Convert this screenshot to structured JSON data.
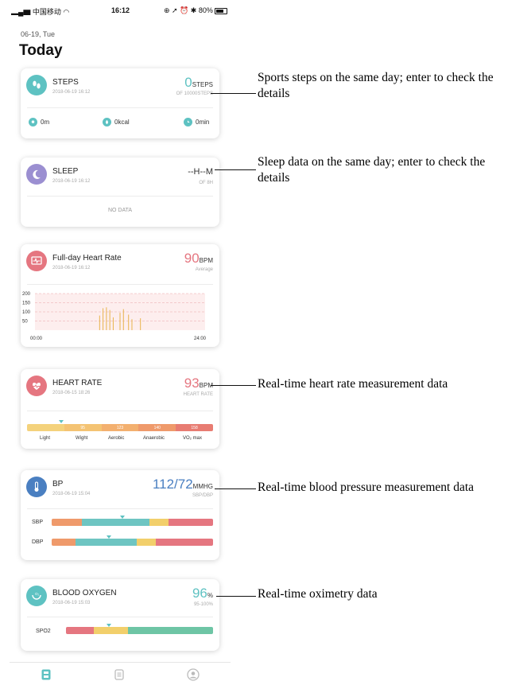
{
  "status_bar": {
    "carrier": "中国移动",
    "time": "16:12",
    "battery": "80%"
  },
  "header": {
    "date": "06-19, Tue",
    "title": "Today"
  },
  "steps": {
    "title": "STEPS",
    "time": "2018-06-19 16:12",
    "value": "0",
    "unit": "STEPS",
    "goal": "OF 10000STEPS",
    "distance": "0m",
    "calories": "0kcal",
    "duration": "0min"
  },
  "sleep": {
    "title": "SLEEP",
    "time": "2018-06-19 16:12",
    "value": "--H--M",
    "goal": "OF 8H",
    "empty": "NO DATA"
  },
  "fullday_hr": {
    "title": "Full-day Heart Rate",
    "time": "2018-06-19 16:12",
    "value": "90",
    "unit": "BPM",
    "note": "Average",
    "y_ticks": [
      "200",
      "150",
      "100",
      "50"
    ],
    "x_start": "00:00",
    "x_end": "24:00"
  },
  "heart_rate": {
    "title": "HEART RATE",
    "time": "2018-06-15 18:26",
    "value": "93",
    "unit": "BPM",
    "note": "HEART RATE",
    "marks": [
      "95",
      "123",
      "140",
      "158"
    ],
    "zones": [
      "Light",
      "Wight",
      "Aerobic",
      "Anaerobic",
      "VO₂ max"
    ]
  },
  "bp": {
    "title": "BP",
    "time": "2018-06-19 15:04",
    "value": "112/72",
    "unit": "MMHG",
    "note": "SBP/DBP",
    "sbp_label": "SBP",
    "dbp_label": "DBP"
  },
  "oxygen": {
    "title": "BLOOD OXYGEN",
    "time": "2018-06-19 15:03",
    "value": "96",
    "unit": "%",
    "note": "95-100%",
    "label": "SPO2"
  },
  "annotations": {
    "steps": "Sports steps on the same day; enter to check the details",
    "sleep": "Sleep data on the same day; enter to check the details",
    "hr": "Real-time heart rate measurement data",
    "bp": "Real-time blood pressure measurement data",
    "oxygen": "Real-time oximetry data"
  },
  "colors": {
    "teal": "#5ec2c2",
    "red": "#e57680",
    "blue": "#4a7fc1",
    "purple": "#9b8fd1",
    "orange": "#ef9a6b",
    "yellow": "#f2cf6b"
  },
  "chart_data": {
    "type": "bar",
    "title": "Full-day Heart Rate",
    "x_labels": [
      "00:00",
      "24:00"
    ],
    "ylim": [
      0,
      200
    ],
    "y_ticks": [
      50,
      100,
      150,
      200
    ],
    "bars": [
      {
        "x": 0.38,
        "y": 80
      },
      {
        "x": 0.4,
        "y": 120
      },
      {
        "x": 0.42,
        "y": 125
      },
      {
        "x": 0.44,
        "y": 110
      },
      {
        "x": 0.46,
        "y": 70
      },
      {
        "x": 0.5,
        "y": 95
      },
      {
        "x": 0.52,
        "y": 115
      },
      {
        "x": 0.55,
        "y": 85
      },
      {
        "x": 0.57,
        "y": 60
      },
      {
        "x": 0.62,
        "y": 65
      }
    ]
  }
}
